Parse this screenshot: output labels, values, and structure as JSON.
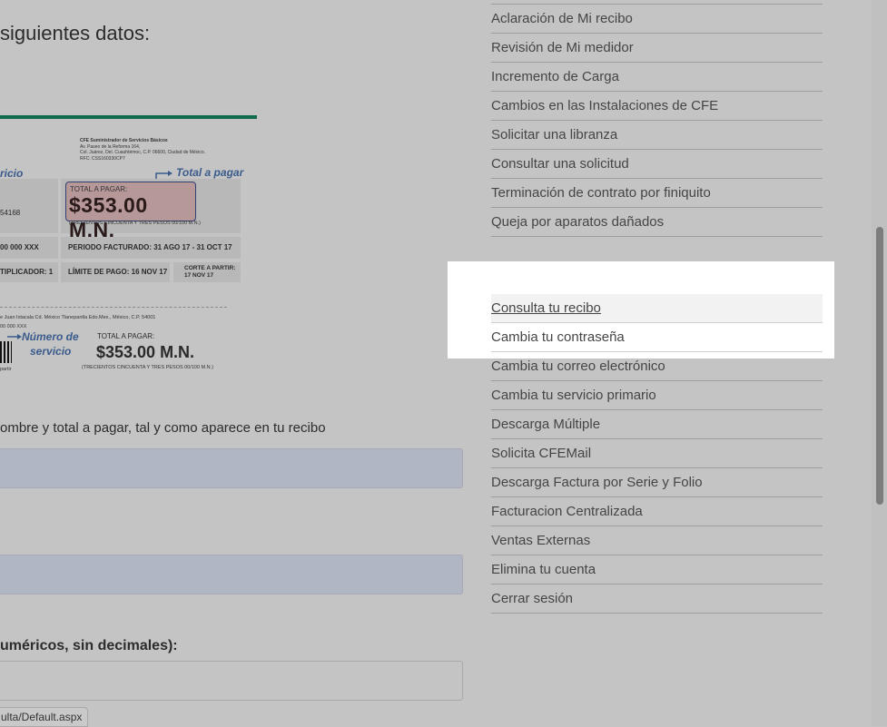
{
  "main": {
    "heading": "siguientes datos:",
    "instruction": "ombre y total a pagar, tal y como aparece en tu recibo",
    "amount_label": "uméricos, sin decimales):"
  },
  "receipt": {
    "company": "CFE Suministrador de Servicios Básicos",
    "address_1": "Av. Paseo de la Reforma 164,",
    "address_2": "Col. Juárez, Del. Cuauhtémoc, C.P. 06600, Ciudad de México.",
    "rfc": "RFC: CSS160330CP7",
    "tag_servicio": "ricio",
    "tag_total": "Total a pagar",
    "num_fragment": "54168",
    "total_label": "TOTAL A PAGAR:",
    "total_amount": "$353.00 M.N.",
    "total_words": "(TRECIENTOS CINCUENTA Y TRES PESOS 00/100 M.N.)",
    "num_fragment_2": "00 000 XXX",
    "periodo": "PERIODO FACTURADO: 31 AGO 17 - 31 OCT 17",
    "multiplicador": "TIPLICADOR: 1",
    "limite": "LÍMITE DE PAGO: 16 NOV 17",
    "corte_1": "CORTE A PARTIR:",
    "corte_2": "17 NOV 17",
    "address_bottom": "e Juan Ixtacala Cd. México Tlanepantla Edo.Mex., México, C.P. 54001",
    "bottom_num": "00 000 XXX",
    "numero_label_1": "Número de",
    "numero_label_2": "servicio",
    "bottom_total_label": "TOTAL A PAGAR:",
    "bottom_total_amount": "$353.00 M.N.",
    "bottom_total_words": "(TRECIENTOS CINCUENTA Y TRES PESOS 00/100 M.N.)",
    "bottom_partir": "partir"
  },
  "status_bar": {
    "url": "ulta/Default.aspx"
  },
  "sidebar": {
    "menu_top": [
      "Aclaración de Mi recibo",
      "Revisión de Mi medidor",
      "Incremento de Carga",
      "Cambios en las Instalaciones de CFE",
      "Solicitar una libranza",
      "Consultar una solicitud",
      "Terminación de contrato por finiquito",
      "Queja por aparatos dañados"
    ],
    "popup_items": [
      "Consulta tu recibo",
      "Cambia tu contraseña"
    ],
    "menu_bottom": [
      "Cambia tu correo electrónico",
      "Cambia tu servicio primario",
      "Descarga Múltiple",
      "Solicita CFEMail",
      "Descarga Factura por Serie y Folio",
      "Facturacion Centralizada",
      "Ventas Externas",
      "Elimina tu cuenta",
      "Cerrar sesión"
    ]
  }
}
